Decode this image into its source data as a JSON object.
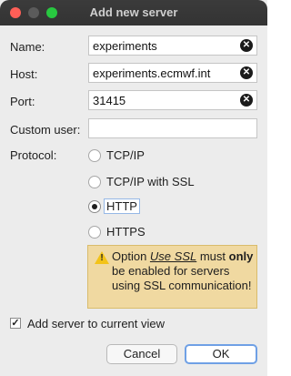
{
  "window": {
    "title": "Add new server"
  },
  "form": {
    "name": {
      "label": "Name:",
      "value": "experiments"
    },
    "host": {
      "label": "Host:",
      "value": "experiments.ecmwf.int"
    },
    "port": {
      "label": "Port:",
      "value": "31415"
    },
    "custom_user": {
      "label": "Custom user:",
      "value": ""
    },
    "protocol": {
      "label": "Protocol:",
      "options": [
        "TCP/IP",
        "TCP/IP with SSL",
        "HTTP",
        "HTTPS"
      ],
      "selected": "HTTP"
    }
  },
  "warning": {
    "part1": "Option ",
    "option_name": "Use SSL",
    "part2": " must ",
    "emphasis": "only",
    "part3": " be enabled for servers using SSL communication!"
  },
  "add_to_view": {
    "label": "Add server to current view",
    "checked": true,
    "mark": "✓"
  },
  "buttons": {
    "cancel": "Cancel",
    "ok": "OK"
  },
  "icons": {
    "clear": "clear-icon",
    "warning": "warning-icon"
  },
  "colors": {
    "accent": "#6fa0e5",
    "warning_bg": "#f0d9a1"
  }
}
